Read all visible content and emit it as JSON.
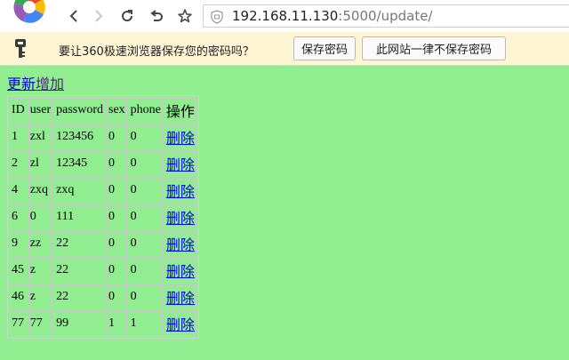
{
  "browser": {
    "address_host": "192.168.11.130",
    "address_rest": ":5000/update/"
  },
  "password_bar": {
    "message": "要让360极速浏览器保存您的密码吗？",
    "save_label": "保存密码",
    "never_label": "此网站一律不保存密码"
  },
  "page": {
    "update_link": "更新",
    "add_link": "增加",
    "table": {
      "headers": [
        "ID",
        "user",
        "password",
        "sex",
        "phone",
        "操作"
      ],
      "rows": [
        {
          "id": "1",
          "user": "zxl",
          "password": "123456",
          "sex": "0",
          "phone": "0",
          "action": "删除"
        },
        {
          "id": "2",
          "user": "zl",
          "password": "12345",
          "sex": "0",
          "phone": "0",
          "action": "删除"
        },
        {
          "id": "4",
          "user": "zxq",
          "password": "zxq",
          "sex": "0",
          "phone": "0",
          "action": "删除"
        },
        {
          "id": "6",
          "user": "0",
          "password": "111",
          "sex": "0",
          "phone": "0",
          "action": "删除"
        },
        {
          "id": "9",
          "user": "zz",
          "password": "22",
          "sex": "0",
          "phone": "0",
          "action": "删除"
        },
        {
          "id": "45",
          "user": "z",
          "password": "22",
          "sex": "0",
          "phone": "0",
          "action": "删除"
        },
        {
          "id": "46",
          "user": "z",
          "password": "22",
          "sex": "0",
          "phone": "0",
          "action": "删除"
        },
        {
          "id": "77",
          "user": "77",
          "password": "99",
          "sex": "1",
          "phone": "1",
          "action": "删除"
        }
      ]
    }
  },
  "colors": {
    "page_background": "#90ee90",
    "link": "#0000ee",
    "visited_link": "#551a8b",
    "password_bar_background": "#fdf5d3"
  },
  "icons": [
    "browser-logo-icon",
    "back-icon",
    "forward-icon",
    "reload-icon",
    "undo-icon",
    "star-icon",
    "shield-icon",
    "key-icon"
  ]
}
